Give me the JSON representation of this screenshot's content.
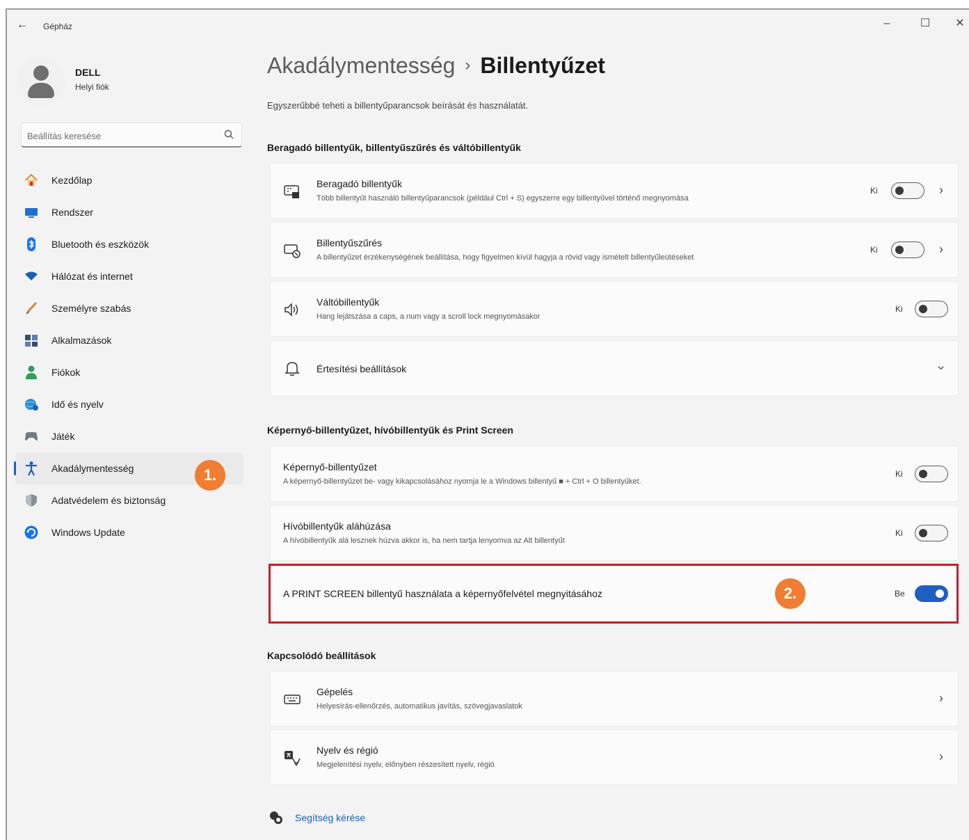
{
  "window": {
    "title": "Gépház",
    "back_label": "←",
    "min_label": "–",
    "max_label": "☐",
    "close_label": "✕"
  },
  "profile": {
    "name": "DELL",
    "account_type": "Helyi fiók"
  },
  "search": {
    "placeholder": "Beállítás keresése"
  },
  "nav": {
    "items": [
      {
        "label": "Kezdőlap",
        "icon": "home-icon"
      },
      {
        "label": "Rendszer",
        "icon": "system-icon"
      },
      {
        "label": "Bluetooth és eszközök",
        "icon": "bluetooth-icon"
      },
      {
        "label": "Hálózat és internet",
        "icon": "wifi-icon"
      },
      {
        "label": "Személyre szabás",
        "icon": "brush-icon"
      },
      {
        "label": "Alkalmazások",
        "icon": "apps-icon"
      },
      {
        "label": "Fiókok",
        "icon": "accounts-icon"
      },
      {
        "label": "Idő és nyelv",
        "icon": "globe-clock-icon"
      },
      {
        "label": "Játék",
        "icon": "gamepad-icon"
      },
      {
        "label": "Akadálymentesség",
        "icon": "accessibility-icon",
        "active": true
      },
      {
        "label": "Adatvédelem és biztonság",
        "icon": "shield-icon"
      },
      {
        "label": "Windows Update",
        "icon": "update-icon"
      }
    ]
  },
  "badges": {
    "step1": "1.",
    "step2": "2."
  },
  "main": {
    "breadcrumb_parent": "Akadálymentesség",
    "breadcrumb_sep": "›",
    "breadcrumb_current": "Billentyűzet",
    "description": "Egyszerűbbé teheti a billentyűparancsok beírását és használatát.",
    "section1_title": "Beragadó billentyűk, billentyűszűrés és váltóbillentyűk",
    "section2_title": "Képernyő-billentyűzet, hívóbillentyűk és Print Screen",
    "section3_title": "Kapcsolódó beállítások",
    "sticky": {
      "title": "Beragadó billentyűk",
      "sub": "Több billentyűt használó billentyűparancsok (például Ctrl + S) egyszerre egy billentyűvel történő megnyomása",
      "state": "Ki"
    },
    "filter": {
      "title": "Billentyűszűrés",
      "sub": "A billentyűzet érzékenységének beállítása, hogy figyelmen kívül hagyja a rövid vagy ismételt billentyűleütéseket",
      "state": "Ki"
    },
    "toggle_keys": {
      "title": "Váltóbillentyűk",
      "sub": "Hang lejátszása a caps, a num vagy a scroll lock megnyomásakor",
      "state": "Ki"
    },
    "notifications": {
      "title": "Értesítési beállítások"
    },
    "osk": {
      "title": "Képernyő-billentyűzet",
      "sub": "A képernyő-billentyűzet be- vagy kikapcsolásához nyomja le a Windows billentyű ■ + Ctrl + O billentyűket.",
      "state": "Ki"
    },
    "access_keys": {
      "title": "Hívóbillentyűk aláhúzása",
      "sub": "A hívóbillentyűk alá lesznek húzva akkor is, ha nem tartja lenyomva az Alt billentyűt",
      "state": "Ki"
    },
    "print_screen": {
      "title": "A PRINT SCREEN billentyű használata a képernyőfelvétel megnyitásához",
      "state": "Be"
    },
    "typing": {
      "title": "Gépelés",
      "sub": "Helyesírás-ellenőrzés, automatikus javítás, szövegjavaslatok"
    },
    "language": {
      "title": "Nyelv és régió",
      "sub": "Megjelenítési nyelv, előnyben részesített nyelv, régió"
    },
    "help_label": "Segítség kérése",
    "toggle_states": {
      "sticky": false,
      "filter": false,
      "toggle_keys": false,
      "osk": false,
      "access_keys": false,
      "print_screen": true
    },
    "accent_color": "#1f5fbf",
    "highlight_color": "#c81e2b",
    "badge_color": "#f07d31"
  }
}
